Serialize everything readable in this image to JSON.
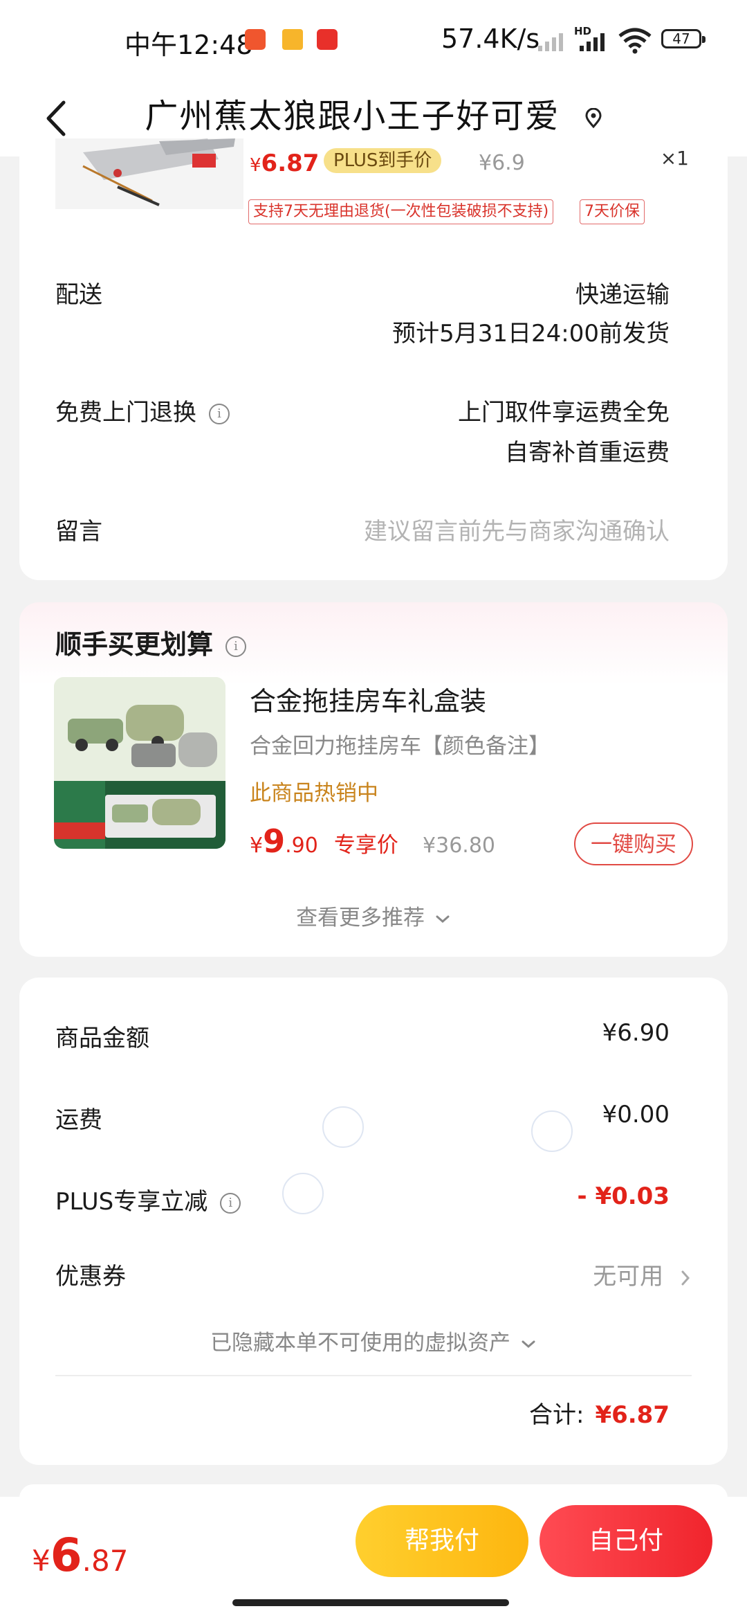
{
  "status_bar": {
    "time": "中午12:48",
    "network_speed": "57.4K/s",
    "network_type": "HD",
    "battery": "47"
  },
  "nav": {
    "title": "广州蕉太狼跟小王子好可爱",
    "back_icon": "chevron-left-icon",
    "location_icon": "location-pin-icon"
  },
  "order_item": {
    "price_symbol": "¥",
    "price": "6.87",
    "plus_badge": "PLUS到手价",
    "original_price": "¥6.9",
    "quantity": "×1",
    "tag_return": "支持7天无理由退货(一次性包装破损不支持)",
    "tag_price_protect": "7天价保"
  },
  "delivery": {
    "label": "配送",
    "method": "快递运输",
    "eta": "预计5月31日24:00前发货"
  },
  "free_return": {
    "label": "免费上门退换",
    "line1": "上门取件享运费全免",
    "line2": "自寄补首重运费"
  },
  "message": {
    "label": "留言",
    "placeholder": "建议留言前先与商家沟通确认"
  },
  "recommend": {
    "title": "顺手买更划算",
    "product_name": "合金拖挂房车礼盒装",
    "product_sub": "合金回力拖挂房车【颜色备注】",
    "hot_text": "此商品热销中",
    "price_symbol": "¥",
    "price_int": "9",
    "price_dec": ".90",
    "price_label": "专享价",
    "original_price": "¥36.80",
    "buy_button": "一键购买",
    "more_text": "查看更多推荐"
  },
  "summary": {
    "goods_label": "商品金额",
    "goods_value": "¥6.90",
    "shipping_label": "运费",
    "shipping_value": "¥0.00",
    "plus_label": "PLUS专享立减",
    "plus_value": "- ¥0.03",
    "coupon_label": "优惠券",
    "coupon_value": "无可用",
    "hidden_assets": "已隐藏本单不可使用的虚拟资产",
    "total_label": "合计:",
    "total_value": "¥6.87"
  },
  "bottom": {
    "symbol": "¥",
    "int": "6",
    "dec": ".87",
    "help_pay": "帮我付",
    "self_pay": "自己付"
  },
  "colors": {
    "accent_red": "#e2231a",
    "plus_gold": "#f7e08a",
    "help_pay_yellow": "#fdb60f",
    "hot_orange": "#c9841d"
  }
}
